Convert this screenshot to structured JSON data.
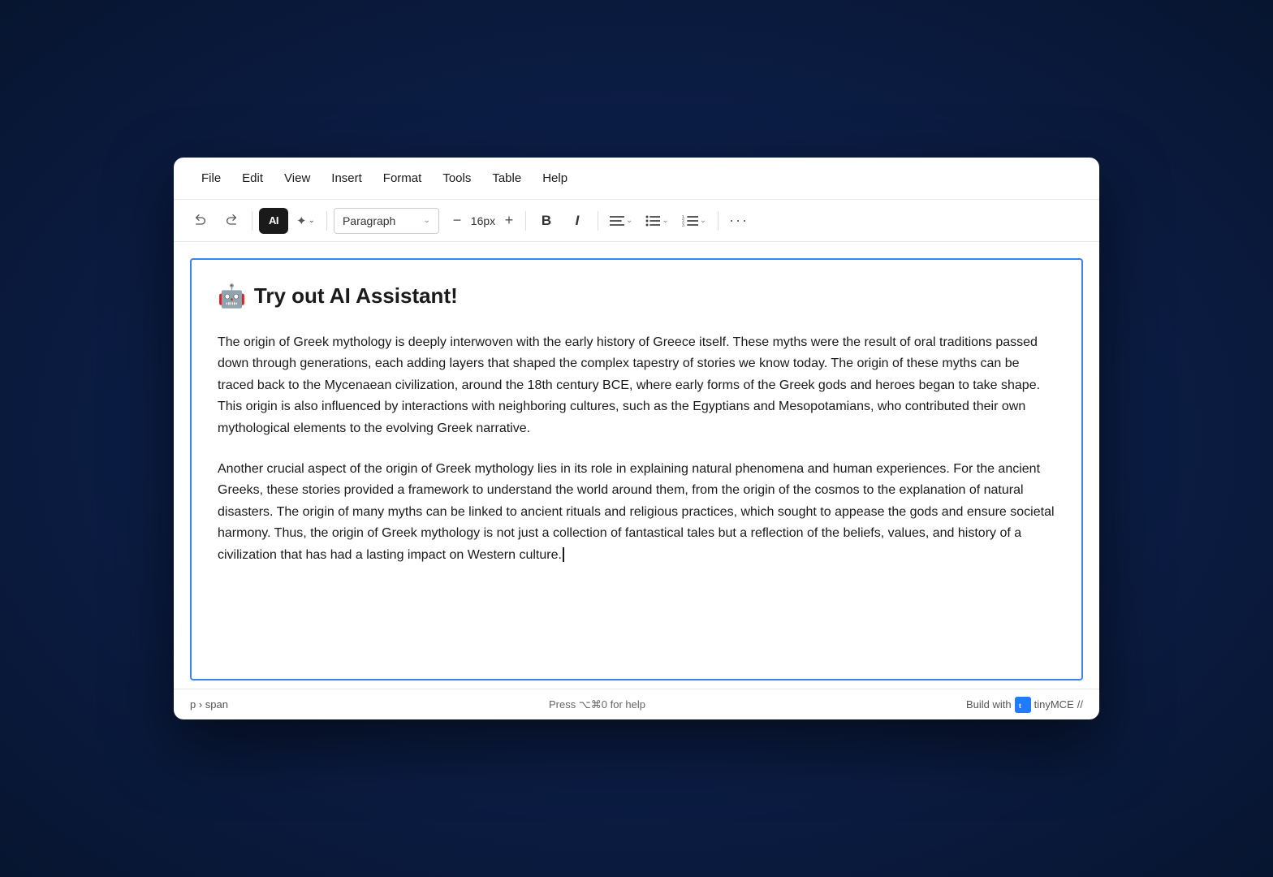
{
  "menu": {
    "items": [
      {
        "id": "file",
        "label": "File"
      },
      {
        "id": "edit",
        "label": "Edit"
      },
      {
        "id": "view",
        "label": "View"
      },
      {
        "id": "insert",
        "label": "Insert"
      },
      {
        "id": "format",
        "label": "Format"
      },
      {
        "id": "tools",
        "label": "Tools"
      },
      {
        "id": "table",
        "label": "Table"
      },
      {
        "id": "help",
        "label": "Help"
      }
    ]
  },
  "toolbar": {
    "undo_label": "↩",
    "redo_label": "↪",
    "ai_label": "AI",
    "magic_label": "✦",
    "chevron_down": "⌄",
    "paragraph_label": "Paragraph",
    "font_size": "16px",
    "decrease_label": "−",
    "increase_label": "+",
    "bold_label": "B",
    "italic_label": "I",
    "align_label": "≡",
    "list_label": "≔",
    "ordered_list_label": "≙",
    "more_label": "···"
  },
  "editor": {
    "border_color": "#3b82f6",
    "heading": {
      "emoji": "🤖",
      "text": "Try out AI Assistant!"
    },
    "paragraphs": [
      "The origin of Greek mythology is deeply interwoven with the early history of Greece itself. These myths were the result of oral traditions passed down through generations, each adding layers that shaped the complex tapestry of stories we know today. The origin of these myths can be traced back to the Mycenaean civilization, around the 18th century BCE, where early forms of the Greek gods and heroes began to take shape. This origin is also influenced by interactions with neighboring cultures, such as the Egyptians and Mesopotamians, who contributed their own mythological elements to the evolving Greek narrative.",
      "Another crucial aspect of the origin of Greek mythology lies in its role in explaining natural phenomena and human experiences. For the ancient Greeks, these stories provided a framework to understand the world around them, from the origin of the cosmos to the explanation of natural disasters. The origin of many myths can be linked to ancient rituals and religious practices, which sought to appease the gods and ensure societal harmony. Thus, the origin of Greek mythology is not just a collection of fantastical tales but a reflection of the beliefs, values, and history of a civilization that has had a lasting impact on Western culture."
    ]
  },
  "statusbar": {
    "breadcrumb": "p › span",
    "shortcut_hint": "Press ⌥⌘0 for help",
    "build_prefix": "Build with",
    "brand_name": "tinyMCE",
    "brand_logo_text": "tM",
    "version_symbol": "//"
  }
}
